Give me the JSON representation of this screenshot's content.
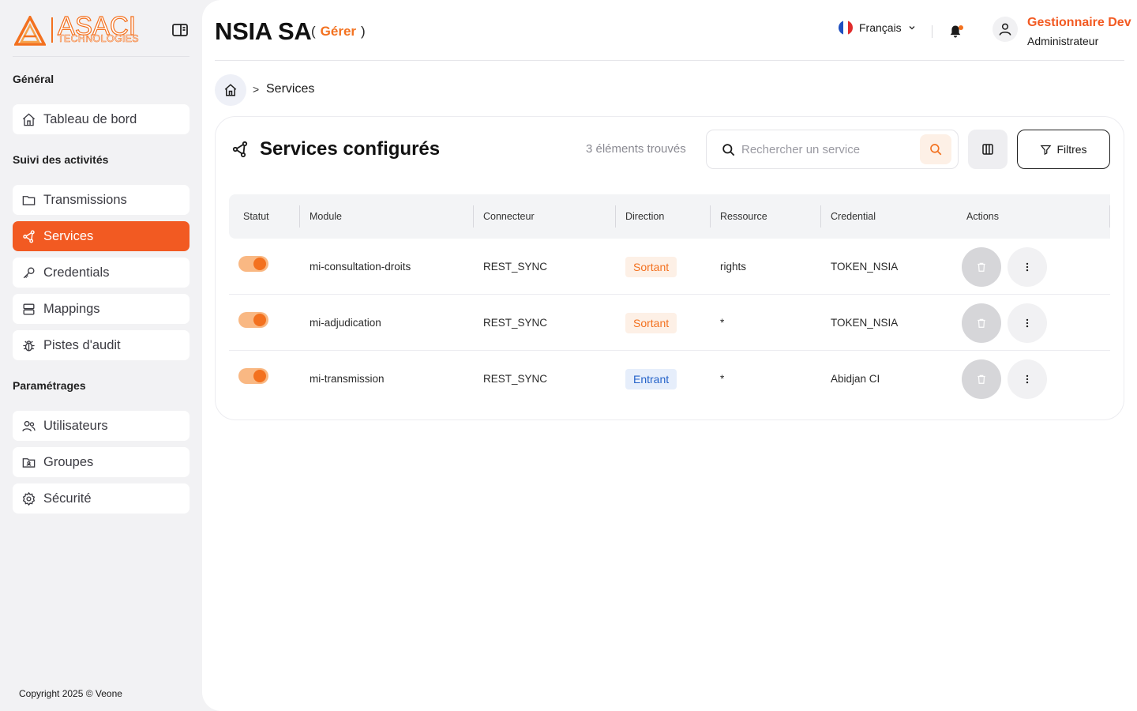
{
  "brand": {
    "logo_text": "ASACI",
    "logo_subtext": "TECHNOLOGIES",
    "accent_color": "#f25a22"
  },
  "sidebar": {
    "sections": [
      {
        "title": "Général"
      },
      {
        "title": "Suivi des activités"
      },
      {
        "title": "Paramétrages"
      }
    ],
    "items": [
      {
        "label": "Tableau de bord",
        "icon": "home-icon"
      },
      {
        "label": "Transmissions",
        "icon": "folder-icon"
      },
      {
        "label": "Services",
        "icon": "share-nodes-icon",
        "active": true
      },
      {
        "label": "Credentials",
        "icon": "key-icon"
      },
      {
        "label": "Mappings",
        "icon": "server-icon"
      },
      {
        "label": "Pistes d'audit",
        "icon": "bug-icon"
      },
      {
        "label": "Utilisateurs",
        "icon": "users-icon"
      },
      {
        "label": "Groupes",
        "icon": "group-folder-icon"
      },
      {
        "label": "Sécurité",
        "icon": "gear-icon"
      }
    ],
    "copyright": "Copyright 2025 © Veone"
  },
  "header": {
    "org_name": "NSIA SA",
    "open_paren": "(",
    "manage_label": "Gérer",
    "close_paren": ")",
    "language": "Français",
    "user_name": "Gestionnaire Dev",
    "user_role": "Administrateur"
  },
  "breadcrumb": {
    "separator": ">",
    "current": "Services"
  },
  "card": {
    "title": "Services configurés",
    "count_text": "3 éléments trouvés",
    "search_placeholder": "Rechercher un service",
    "filters_label": "Filtres"
  },
  "table": {
    "columns": [
      "Statut",
      "Module",
      "Connecteur",
      "Direction",
      "Ressource",
      "Credential",
      "Actions"
    ],
    "rows": [
      {
        "enabled": true,
        "module": "mi-consultation-droits",
        "connector": "REST_SYNC",
        "direction": "Sortant",
        "resource": "rights",
        "credential": "TOKEN_NSIA"
      },
      {
        "enabled": true,
        "module": "mi-adjudication",
        "connector": "REST_SYNC",
        "direction": "Sortant",
        "resource": "*",
        "credential": "TOKEN_NSIA"
      },
      {
        "enabled": true,
        "module": "mi-transmission",
        "connector": "REST_SYNC",
        "direction": "Entrant",
        "resource": "*",
        "credential": "Abidjan CI"
      }
    ]
  }
}
